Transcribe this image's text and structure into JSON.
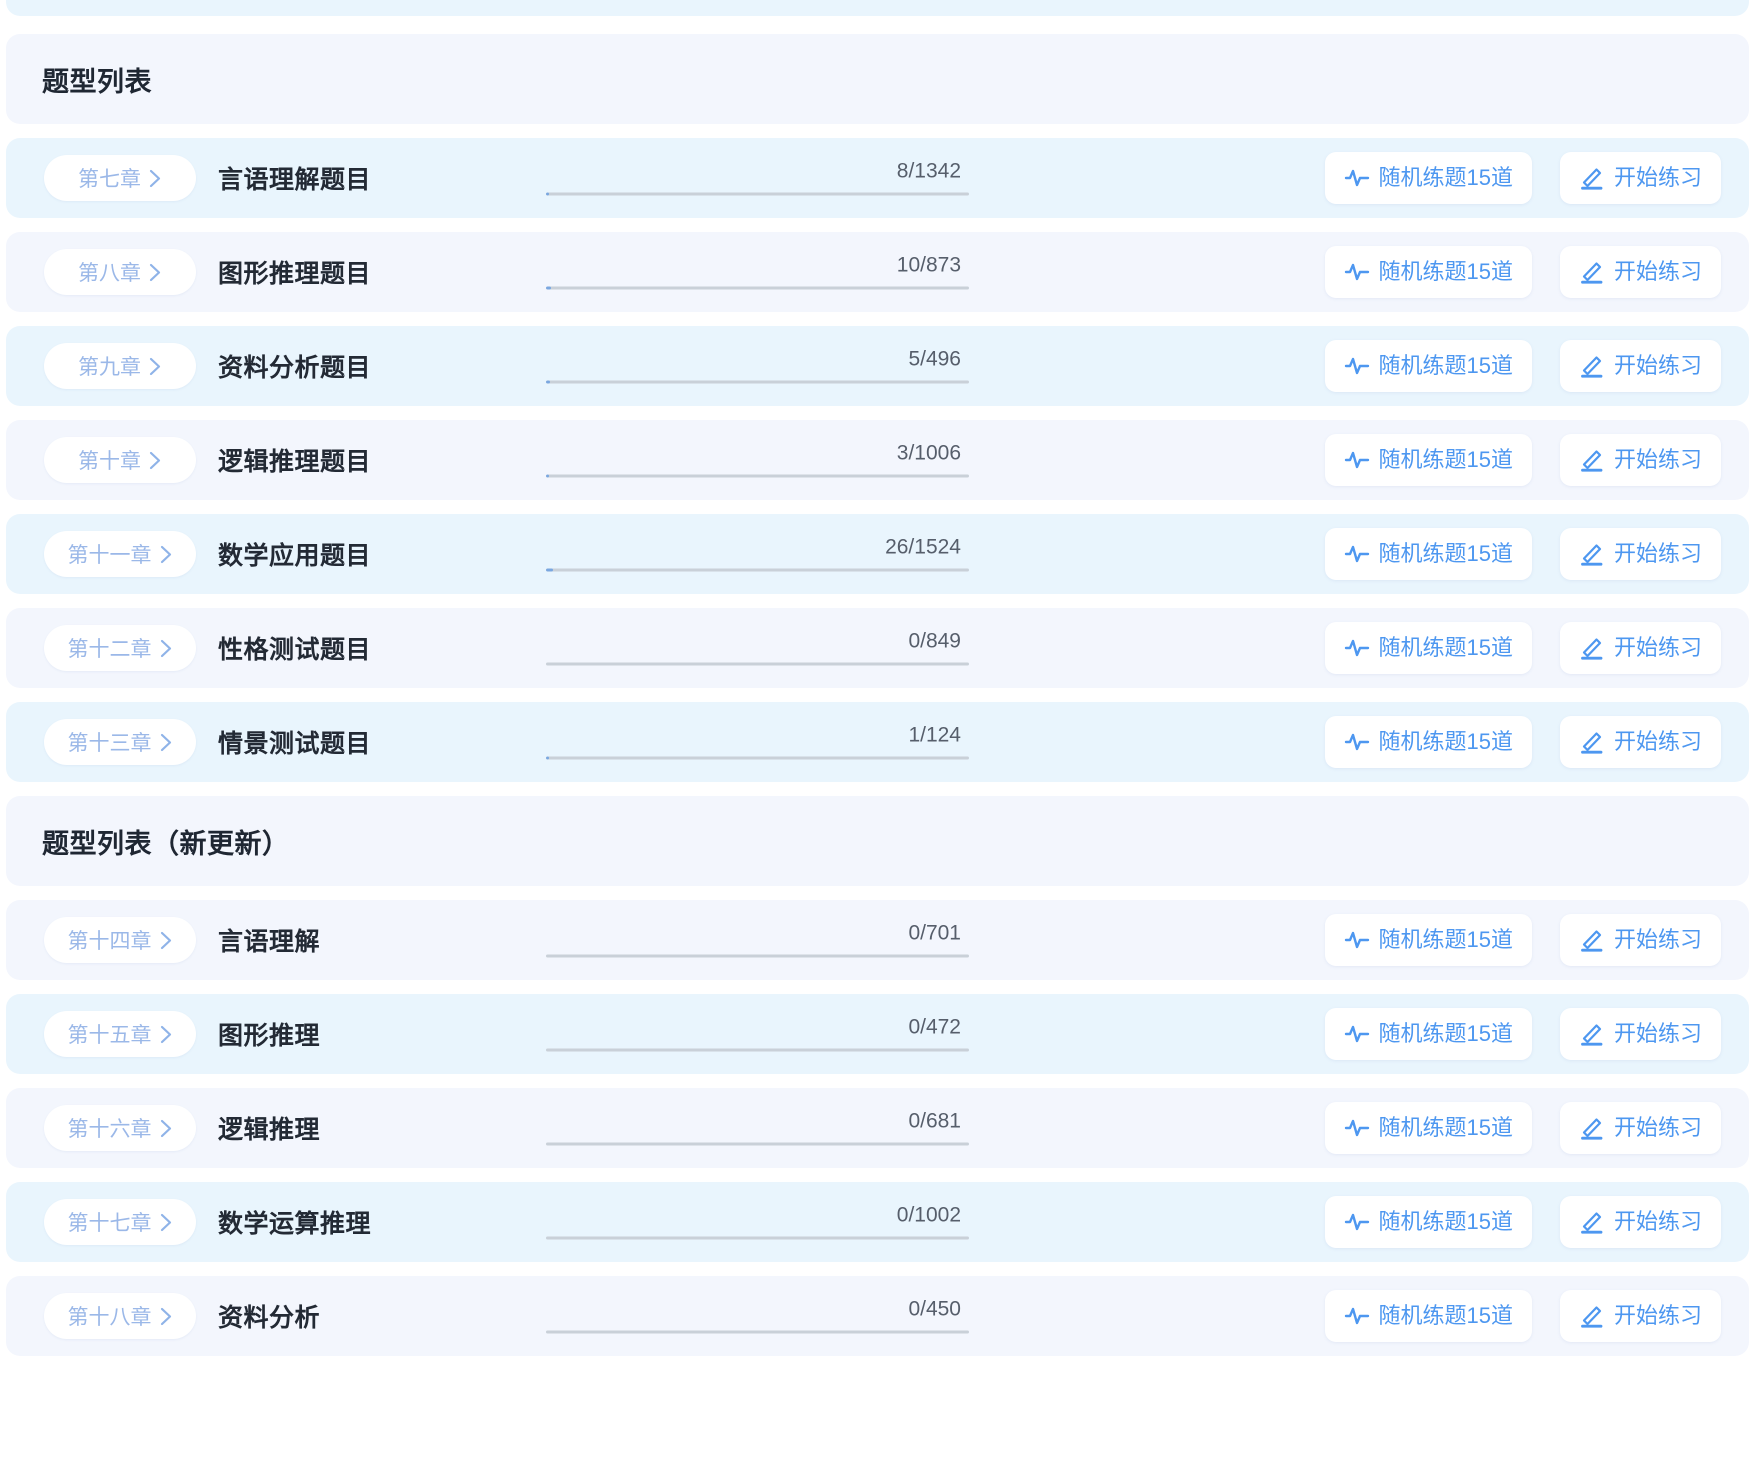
{
  "sections": [
    {
      "title": "题型列表",
      "rows": [
        {
          "chapter": "第七章",
          "title": "言语理解题目",
          "progress_text": "8/1342",
          "done": 8,
          "total": 1342,
          "percent": 0.6,
          "random_label": "随机练题15道",
          "start_label": "开始练习"
        },
        {
          "chapter": "第八章",
          "title": "图形推理题目",
          "progress_text": "10/873",
          "done": 10,
          "total": 873,
          "percent": 1.1,
          "random_label": "随机练题15道",
          "start_label": "开始练习"
        },
        {
          "chapter": "第九章",
          "title": "资料分析题目",
          "progress_text": "5/496",
          "done": 5,
          "total": 496,
          "percent": 1.0,
          "random_label": "随机练题15道",
          "start_label": "开始练习"
        },
        {
          "chapter": "第十章",
          "title": "逻辑推理题目",
          "progress_text": "3/1006",
          "done": 3,
          "total": 1006,
          "percent": 0.3,
          "random_label": "随机练题15道",
          "start_label": "开始练习"
        },
        {
          "chapter": "第十一章",
          "title": "数学应用题目",
          "progress_text": "26/1524",
          "done": 26,
          "total": 1524,
          "percent": 1.7,
          "random_label": "随机练题15道",
          "start_label": "开始练习"
        },
        {
          "chapter": "第十二章",
          "title": "性格测试题目",
          "progress_text": "0/849",
          "done": 0,
          "total": 849,
          "percent": 0,
          "random_label": "随机练题15道",
          "start_label": "开始练习"
        },
        {
          "chapter": "第十三章",
          "title": "情景测试题目",
          "progress_text": "1/124",
          "done": 1,
          "total": 124,
          "percent": 0.8,
          "random_label": "随机练题15道",
          "start_label": "开始练习"
        }
      ]
    },
    {
      "title": "题型列表（新更新）",
      "rows": [
        {
          "chapter": "第十四章",
          "title": "言语理解",
          "progress_text": "0/701",
          "done": 0,
          "total": 701,
          "percent": 0,
          "random_label": "随机练题15道",
          "start_label": "开始练习"
        },
        {
          "chapter": "第十五章",
          "title": "图形推理",
          "progress_text": "0/472",
          "done": 0,
          "total": 472,
          "percent": 0,
          "random_label": "随机练题15道",
          "start_label": "开始练习"
        },
        {
          "chapter": "第十六章",
          "title": "逻辑推理",
          "progress_text": "0/681",
          "done": 0,
          "total": 681,
          "percent": 0,
          "random_label": "随机练题15道",
          "start_label": "开始练习"
        },
        {
          "chapter": "第十七章",
          "title": "数学运算推理",
          "progress_text": "0/1002",
          "done": 0,
          "total": 1002,
          "percent": 0,
          "random_label": "随机练题15道",
          "start_label": "开始练习"
        },
        {
          "chapter": "第十八章",
          "title": "资料分析",
          "progress_text": "0/450",
          "done": 0,
          "total": 450,
          "percent": 0,
          "random_label": "随机练题15道",
          "start_label": "开始练习"
        }
      ]
    }
  ],
  "icons": {
    "chevron": "chevron-right-icon",
    "random": "activity-pulse-icon",
    "start": "pencil-edit-icon"
  },
  "colors": {
    "accent": "#4d97f0",
    "badge_text": "#9bb8e8",
    "row_tint_a": "#e9f5fd",
    "row_tint_b": "#f3f6fd",
    "section_bg": "#f3f6fd",
    "title_text": "#232a35",
    "progress_track": "#c9d0d8",
    "progress_fill": "#7aa7e0"
  }
}
